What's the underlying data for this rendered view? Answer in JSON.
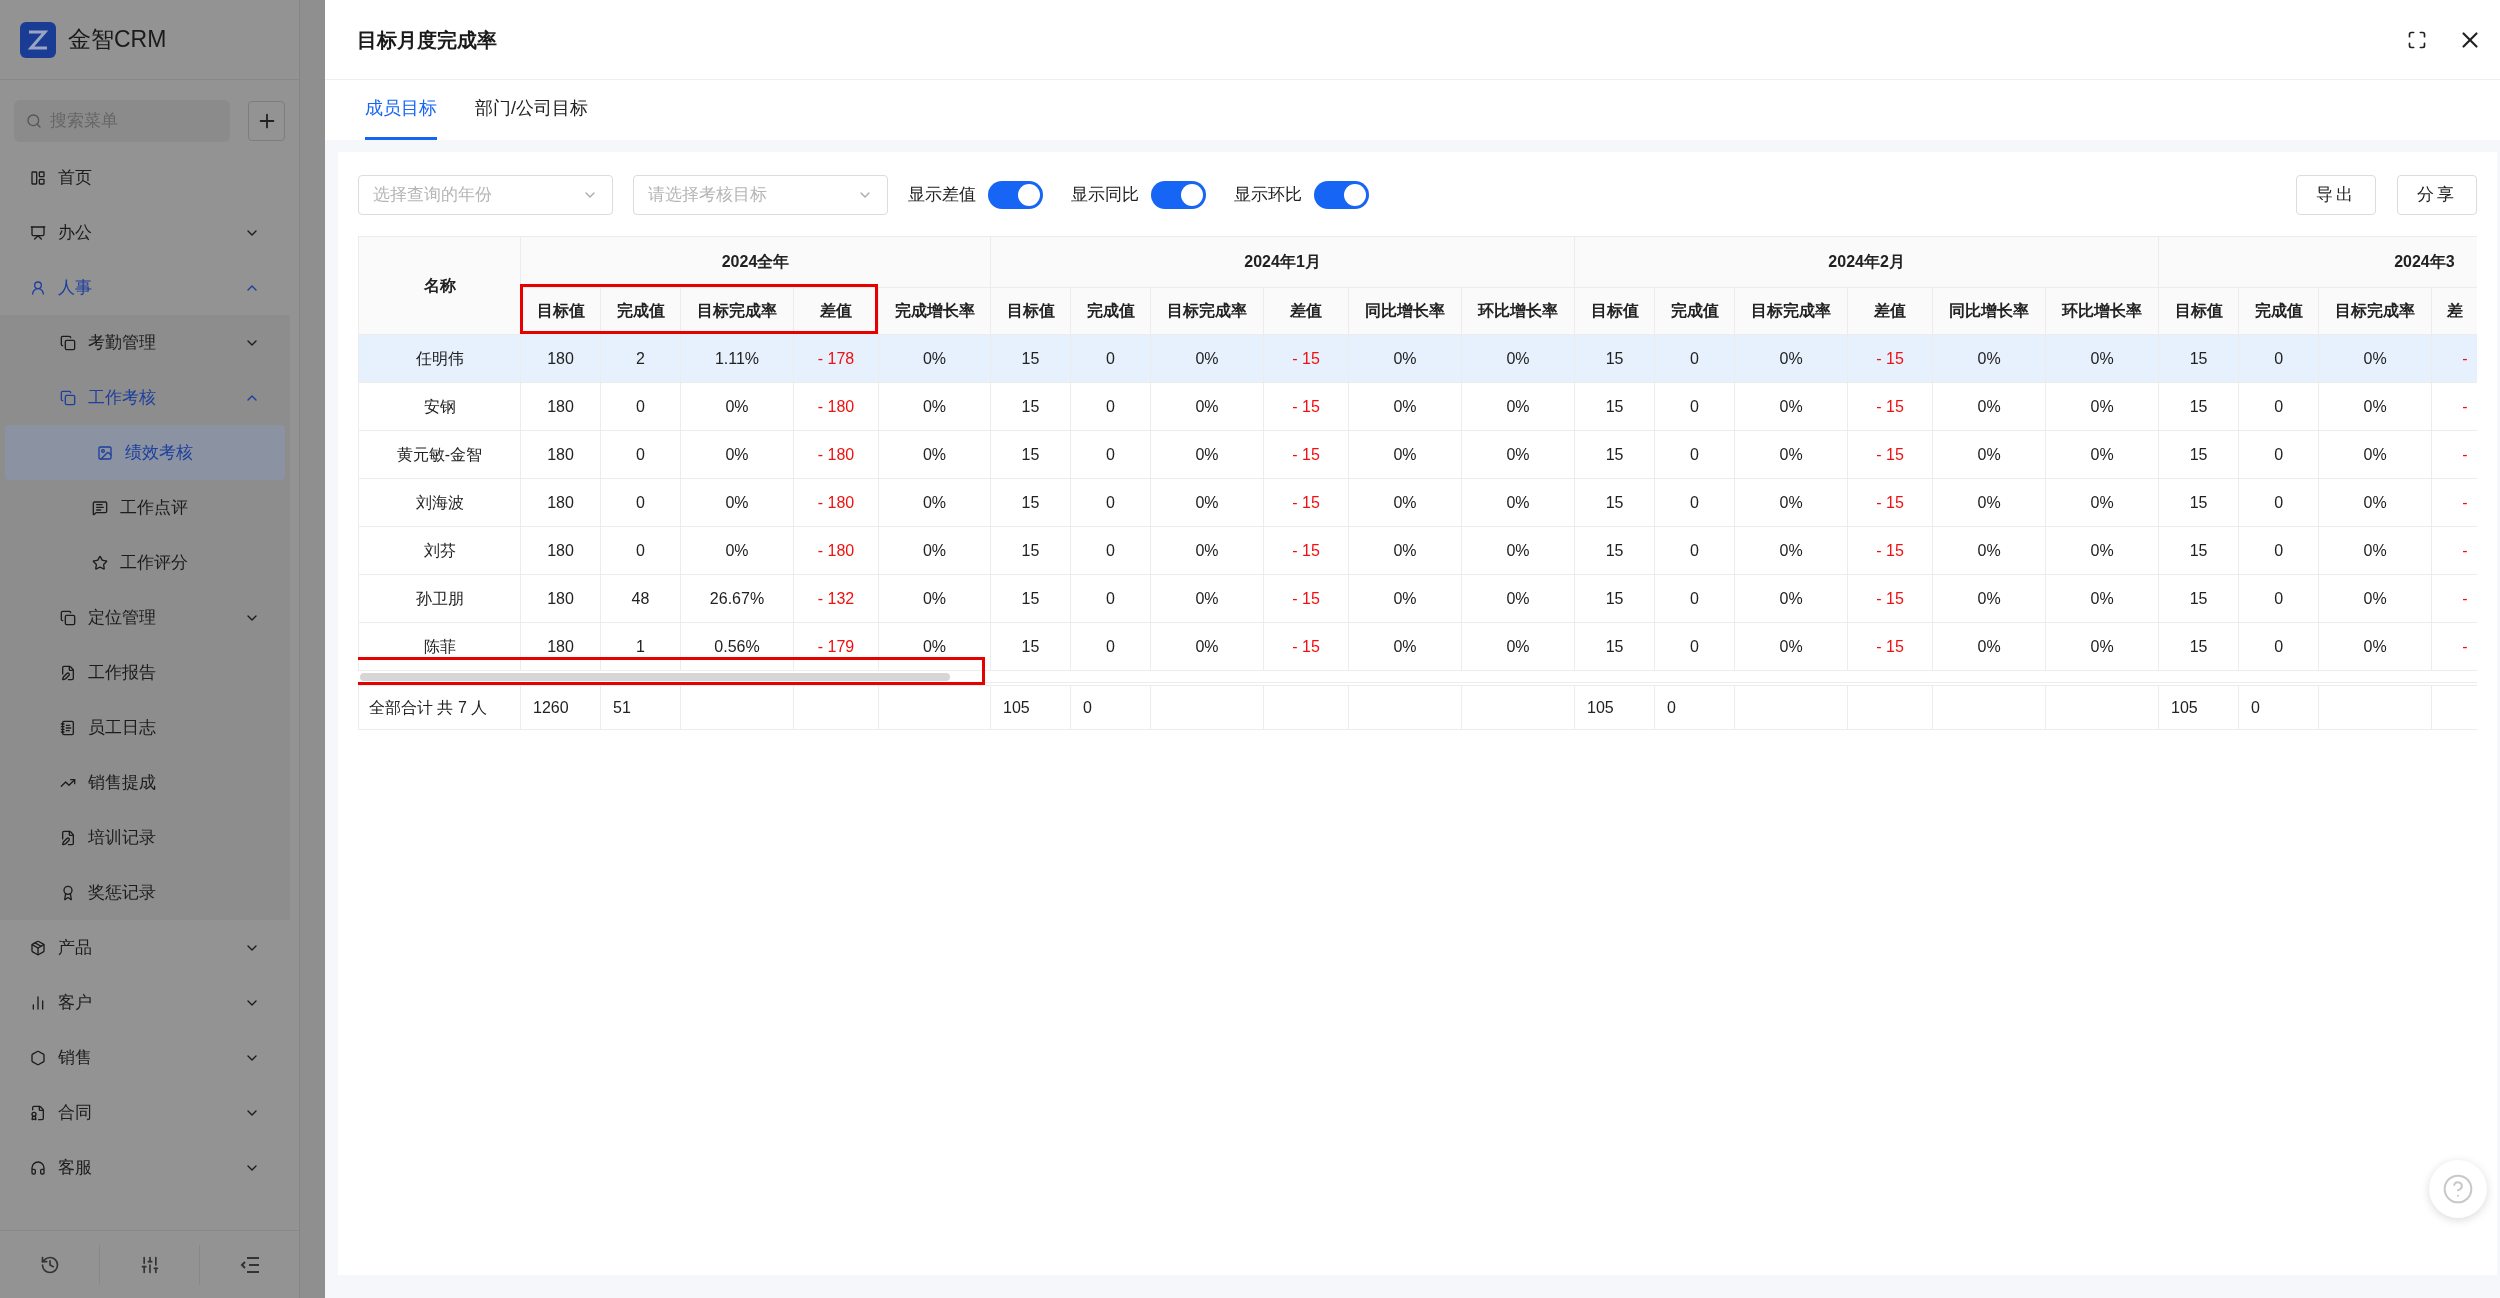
{
  "sidebar": {
    "logo": "金智CRM",
    "search": {
      "placeholder": "搜索菜单"
    },
    "items": [
      {
        "label": "首页",
        "selected": false
      },
      {
        "label": "办公",
        "selected": false,
        "expanded": false
      },
      {
        "label": "人事",
        "selected": false,
        "expanded": true,
        "children": [
          {
            "label": "考勤管理",
            "selected": false,
            "expanded": false
          },
          {
            "label": "工作考核",
            "selected": false,
            "expanded": true,
            "children": [
              {
                "label": "绩效考核",
                "selected": true
              },
              {
                "label": "工作点评",
                "selected": false
              },
              {
                "label": "工作评分",
                "selected": false
              }
            ]
          },
          {
            "label": "定位管理",
            "selected": false,
            "expanded": false
          },
          {
            "label": "工作报告",
            "selected": false
          },
          {
            "label": "员工日志",
            "selected": false
          },
          {
            "label": "销售提成",
            "selected": false
          },
          {
            "label": "培训记录",
            "selected": false
          },
          {
            "label": "奖惩记录",
            "selected": false
          }
        ]
      },
      {
        "label": "产品",
        "selected": false,
        "expanded": false
      },
      {
        "label": "客户",
        "selected": false,
        "expanded": false
      },
      {
        "label": "销售",
        "selected": false,
        "expanded": false
      },
      {
        "label": "合同",
        "selected": false,
        "expanded": false
      },
      {
        "label": "客服",
        "selected": false,
        "expanded": false
      }
    ]
  },
  "drawer": {
    "title": "目标月度完成率",
    "tabs": [
      {
        "label": "成员目标",
        "selected": true
      },
      {
        "label": "部门/公司目标",
        "selected": false
      }
    ],
    "filters": {
      "selects": [
        {
          "placeholder": "选择查询的年份"
        },
        {
          "placeholder": "请选择考核目标"
        }
      ],
      "toggles": [
        {
          "label": "显示差值",
          "on": true
        },
        {
          "label": "显示同比",
          "on": true
        },
        {
          "label": "显示环比",
          "on": true
        }
      ],
      "buttons": [
        "导出",
        "分享"
      ]
    },
    "table": {
      "name_header": "名称",
      "groups": [
        {
          "title": "2024全年",
          "columns": [
            {
              "label": "目标值",
              "kind": "value"
            },
            {
              "label": "完成值",
              "kind": "value"
            },
            {
              "label": "目标完成率",
              "kind": "value"
            },
            {
              "label": "差值",
              "kind": "diff"
            },
            {
              "label": "完成增长率",
              "kind": "value"
            }
          ],
          "totals": [
            "1260",
            "51"
          ]
        },
        {
          "title": "2024年1月",
          "columns": [
            {
              "label": "目标值",
              "kind": "value"
            },
            {
              "label": "完成值",
              "kind": "value"
            },
            {
              "label": "目标完成率",
              "kind": "value"
            },
            {
              "label": "差值",
              "kind": "diff"
            },
            {
              "label": "同比增长率",
              "kind": "value"
            },
            {
              "label": "环比增长率",
              "kind": "value"
            }
          ],
          "totals": [
            "105",
            "0"
          ]
        },
        {
          "title": "2024年2月",
          "columns": [
            {
              "label": "目标值",
              "kind": "value"
            },
            {
              "label": "完成值",
              "kind": "value"
            },
            {
              "label": "目标完成率",
              "kind": "value"
            },
            {
              "label": "差值",
              "kind": "diff"
            },
            {
              "label": "同比增长率",
              "kind": "value"
            },
            {
              "label": "环比增长率",
              "kind": "value"
            }
          ],
          "totals": [
            "105",
            "0"
          ]
        },
        {
          "title": "2024年3",
          "columns": [
            {
              "label": "目标值",
              "kind": "value"
            },
            {
              "label": "完成值",
              "kind": "value"
            },
            {
              "label": "目标完成率",
              "kind": "value"
            },
            {
              "label": "差",
              "kind": "diff"
            }
          ],
          "totals": [
            "105",
            "0"
          ]
        }
      ],
      "rows": [
        {
          "name": "任明伟",
          "selected": true,
          "cells": [
            "180",
            "2",
            "1.11%",
            "- 178",
            "0%",
            "15",
            "0",
            "0%",
            "- 15",
            "0%",
            "0%",
            "15",
            "0",
            "0%",
            "- 15",
            "0%",
            "0%",
            "15",
            "0",
            "0%",
            "-"
          ]
        },
        {
          "name": "安钢",
          "selected": false,
          "cells": [
            "180",
            "0",
            "0%",
            "- 180",
            "0%",
            "15",
            "0",
            "0%",
            "- 15",
            "0%",
            "0%",
            "15",
            "0",
            "0%",
            "- 15",
            "0%",
            "0%",
            "15",
            "0",
            "0%",
            "-"
          ]
        },
        {
          "name": "黄元敏-金智",
          "selected": false,
          "cells": [
            "180",
            "0",
            "0%",
            "- 180",
            "0%",
            "15",
            "0",
            "0%",
            "- 15",
            "0%",
            "0%",
            "15",
            "0",
            "0%",
            "- 15",
            "0%",
            "0%",
            "15",
            "0",
            "0%",
            "-"
          ]
        },
        {
          "name": "刘海波",
          "selected": false,
          "cells": [
            "180",
            "0",
            "0%",
            "- 180",
            "0%",
            "15",
            "0",
            "0%",
            "- 15",
            "0%",
            "0%",
            "15",
            "0",
            "0%",
            "- 15",
            "0%",
            "0%",
            "15",
            "0",
            "0%",
            "-"
          ]
        },
        {
          "name": "刘芬",
          "selected": false,
          "cells": [
            "180",
            "0",
            "0%",
            "- 180",
            "0%",
            "15",
            "0",
            "0%",
            "- 15",
            "0%",
            "0%",
            "15",
            "0",
            "0%",
            "- 15",
            "0%",
            "0%",
            "15",
            "0",
            "0%",
            "-"
          ]
        },
        {
          "name": "孙卫朋",
          "selected": false,
          "cells": [
            "180",
            "48",
            "26.67%",
            "- 132",
            "0%",
            "15",
            "0",
            "0%",
            "- 15",
            "0%",
            "0%",
            "15",
            "0",
            "0%",
            "- 15",
            "0%",
            "0%",
            "15",
            "0",
            "0%",
            "-"
          ]
        },
        {
          "name": "陈菲",
          "selected": false,
          "cells": [
            "180",
            "1",
            "0.56%",
            "- 179",
            "0%",
            "15",
            "0",
            "0%",
            "- 15",
            "0%",
            "0%",
            "15",
            "0",
            "0%",
            "- 15",
            "0%",
            "0%",
            "15",
            "0",
            "0%",
            "-"
          ]
        }
      ],
      "footer_label": "全部合计 共 7 人"
    }
  }
}
